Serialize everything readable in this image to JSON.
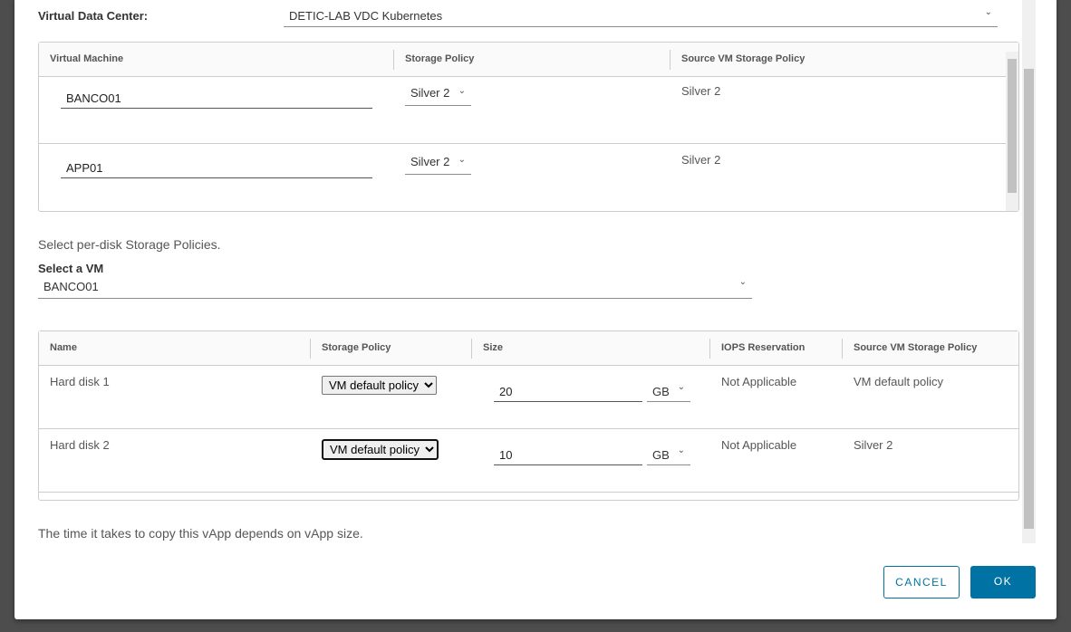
{
  "vdc": {
    "label": "Virtual Data Center:",
    "value": "DETIC-LAB VDC Kubernetes"
  },
  "vm_grid": {
    "headers": [
      "Virtual Machine",
      "Storage Policy",
      "Source VM Storage Policy"
    ],
    "rows": [
      {
        "name": "BANCO01",
        "policy": "Silver 2",
        "source": "Silver 2"
      },
      {
        "name": "APP01",
        "policy": "Silver 2",
        "source": "Silver 2"
      }
    ]
  },
  "per_disk": {
    "text": "Select per-disk Storage Policies.",
    "select_label": "Select a VM",
    "select_value": "BANCO01"
  },
  "disk_grid": {
    "headers": [
      "Name",
      "Storage Policy",
      "Size",
      "IOPS Reservation",
      "Source VM Storage Policy"
    ],
    "rows": [
      {
        "name": "Hard disk 1",
        "policy": "VM default policy",
        "size": "20",
        "unit": "GB",
        "iops": "Not Applicable",
        "source": "VM default policy"
      },
      {
        "name": "Hard disk 2",
        "policy": "VM default policy",
        "size": "10",
        "unit": "GB",
        "iops": "Not Applicable",
        "source": "Silver 2"
      }
    ]
  },
  "note": "The time it takes to copy this vApp depends on vApp size.",
  "buttons": {
    "cancel": "CANCEL",
    "ok": "OK"
  },
  "colors": {
    "primary": "#0072a3"
  }
}
